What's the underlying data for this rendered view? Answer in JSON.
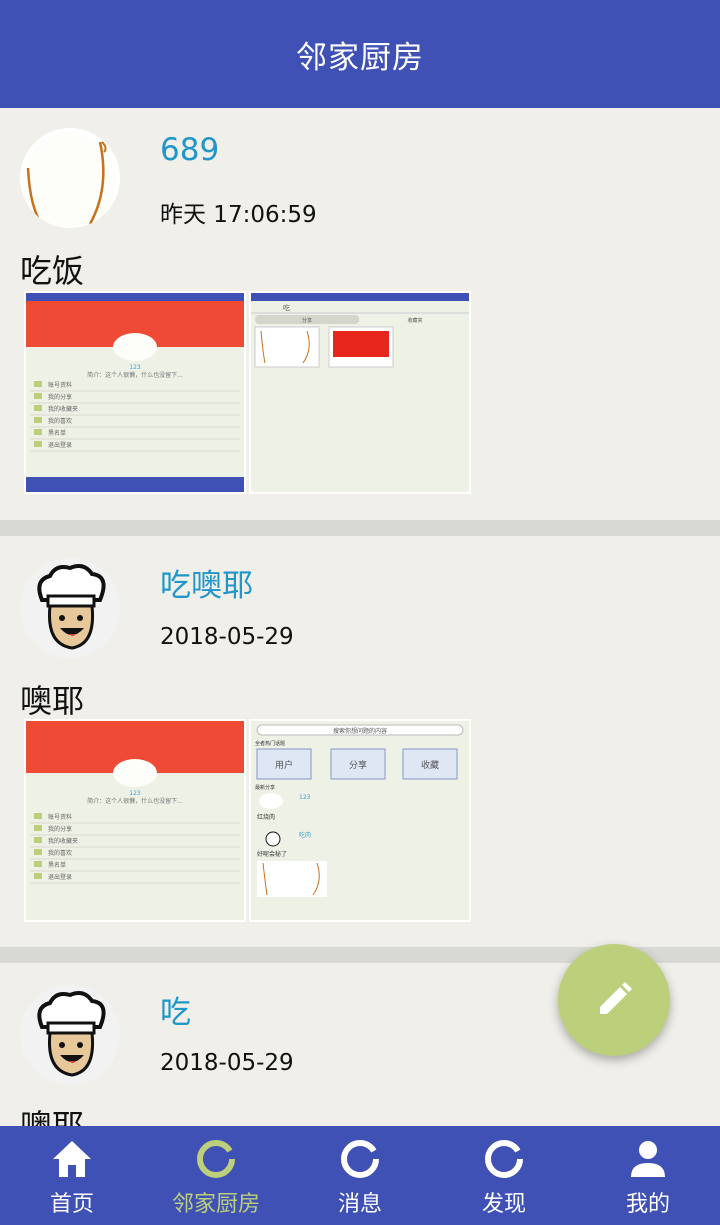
{
  "app": {
    "title": "邻家厨房"
  },
  "posts": [
    {
      "username": "689",
      "time": "昨天 17:06:59",
      "content": "吃饭",
      "avatar_icon": "bread-avatar-icon"
    },
    {
      "username": "吃噢耶",
      "time": "2018-05-29",
      "content": "噢耶",
      "avatar_icon": "chef-avatar-icon"
    },
    {
      "username": "吃",
      "time": "2018-05-29",
      "content": "噢耶",
      "avatar_icon": "chef-avatar-icon"
    }
  ],
  "thumb_text": {
    "profile_intro": "简介：这个人很懒，什么也没留下...",
    "profile_intro_short": "简介：这个人很懒，什么也没留下...",
    "menu": [
      "账号资料",
      "我的分享",
      "我的收藏夹",
      "我的喜欢",
      "黑名单",
      "退出登录"
    ],
    "search_label": "吃",
    "tab_share": "分享",
    "tab_fav": "收藏夹",
    "search_placeholder": "搜索你想问题的内容",
    "popular": "全者热门话题",
    "btn_user": "用户",
    "btn_share": "分享",
    "btn_fav": "收藏",
    "latest": "最新分享",
    "item1_name": "123",
    "item1_desc": "红烧肉",
    "item2_name": "吃肉",
    "item2_desc": "好呢会秘了"
  },
  "fab": {
    "icon": "pencil-icon"
  },
  "nav": [
    {
      "label": "首页",
      "icon": "home-icon",
      "active": false
    },
    {
      "label": "邻家厨房",
      "icon": "ring-icon",
      "active": true
    },
    {
      "label": "消息",
      "icon": "ring-icon",
      "active": false
    },
    {
      "label": "发现",
      "icon": "ring-icon",
      "active": false
    },
    {
      "label": "我的",
      "icon": "person-icon",
      "active": false
    }
  ],
  "colors": {
    "primary": "#3f51b5",
    "accent": "#bccf7a",
    "username": "#2196c9",
    "background": "#efeee8"
  }
}
